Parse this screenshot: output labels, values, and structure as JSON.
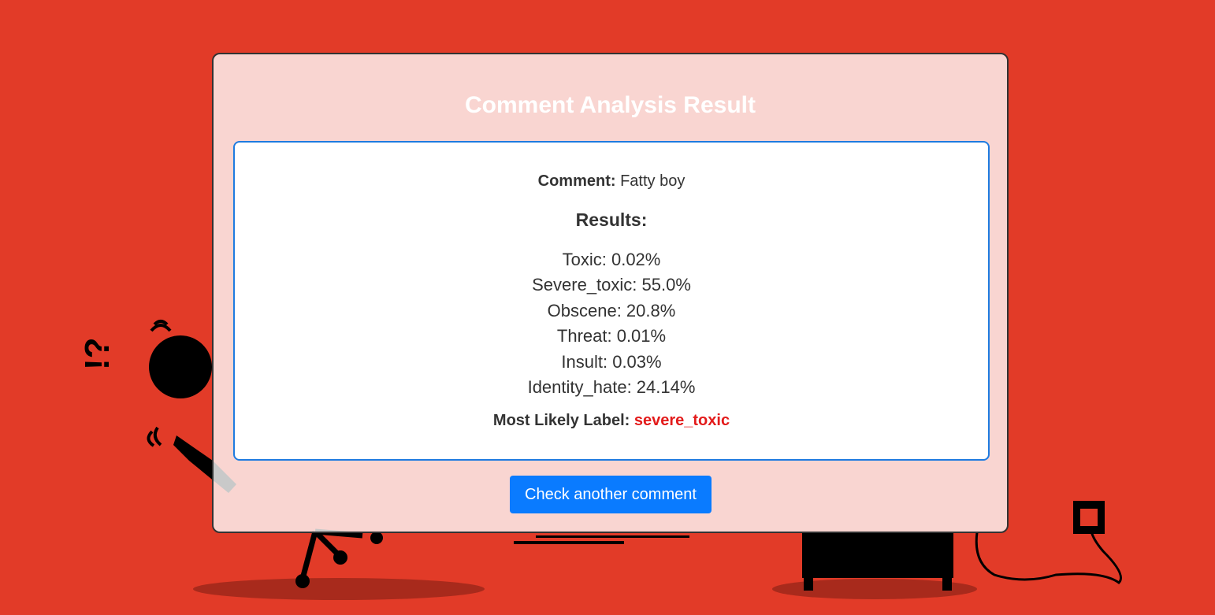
{
  "page": {
    "background_color": "#e23b28",
    "title": "Comment Analysis Result"
  },
  "comment": {
    "label": "Comment:",
    "value": "Fatty boy"
  },
  "results": {
    "heading": "Results:",
    "items": [
      {
        "text": "Toxic: 0.02%",
        "name": "Toxic",
        "percent": 0.02
      },
      {
        "text": "Severe_toxic: 55.0%",
        "name": "Severe_toxic",
        "percent": 55.0
      },
      {
        "text": "Obscene: 20.8%",
        "name": "Obscene",
        "percent": 20.8
      },
      {
        "text": "Threat: 0.01%",
        "name": "Threat",
        "percent": 0.01
      },
      {
        "text": "Insult: 0.03%",
        "name": "Insult",
        "percent": 0.03
      },
      {
        "text": "Identity_hate: 24.14%",
        "name": "Identity_hate",
        "percent": 24.14
      }
    ]
  },
  "most_likely": {
    "label": "Most Likely Label:",
    "value": "severe_toxic",
    "value_color": "#e31b1b"
  },
  "actions": {
    "check_another_label": "Check another comment",
    "button_color": "#0a7bff"
  },
  "background_art": {
    "icon": "office-chaos-illustration",
    "glyph_text": "!?"
  }
}
